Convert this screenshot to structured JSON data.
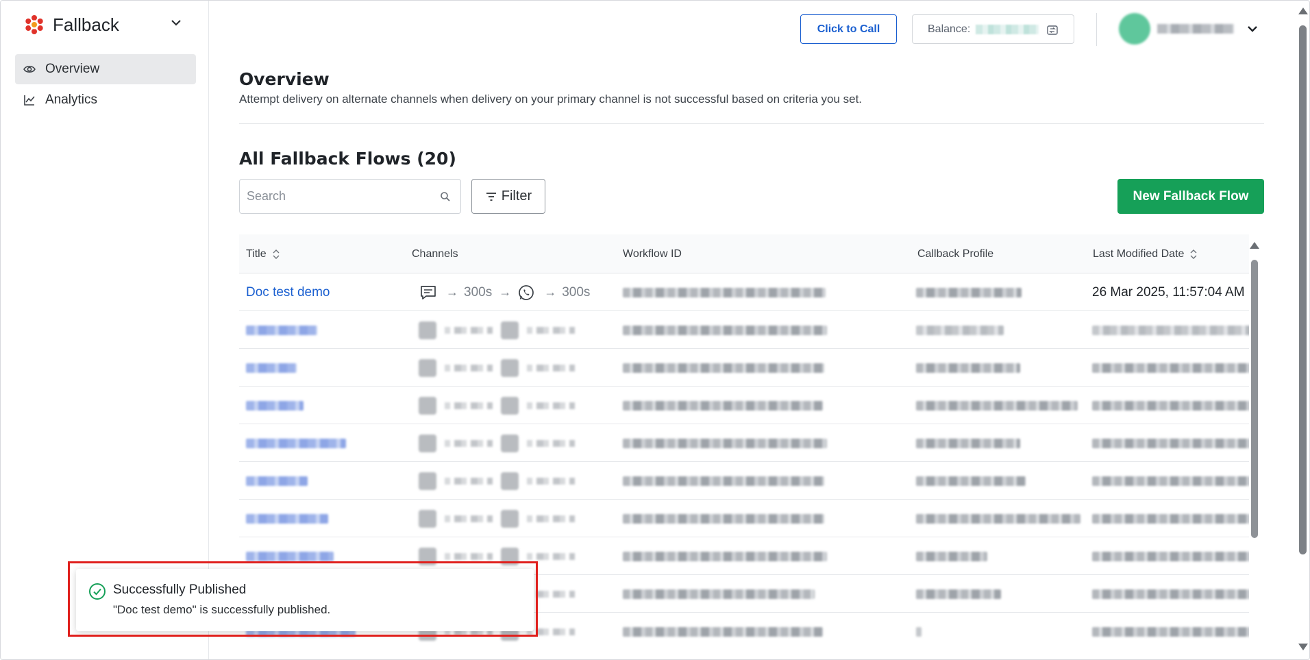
{
  "sidebar": {
    "brand": "Fallback",
    "nav": [
      {
        "label": "Overview",
        "icon": "eye-icon",
        "active": true
      },
      {
        "label": "Analytics",
        "icon": "line-chart-icon",
        "active": false
      }
    ]
  },
  "header": {
    "click_to_call": "Click to Call",
    "balance_label": "Balance:"
  },
  "main": {
    "title": "Overview",
    "description": "Attempt delivery on alternate channels when delivery on your primary channel is not successful based on criteria you set.",
    "section_title": "All Fallback Flows (20)",
    "search_placeholder": "Search",
    "filter_label": "Filter",
    "new_flow_label": "New Fallback Flow"
  },
  "table": {
    "columns": [
      "Title",
      "Channels",
      "Workflow ID",
      "Callback Profile",
      "Last Modified Date"
    ],
    "first_row": {
      "title": "Doc test demo",
      "channels": [
        {
          "icon": "sms-chat-icon",
          "arrow": "→",
          "duration": "300s"
        },
        {
          "icon": "whatsapp-icon",
          "arrow": "→",
          "duration": "300s"
        }
      ],
      "last_modified": "26 Mar 2025, 11:57:04 AM"
    },
    "blurred_rows": 9
  },
  "toast": {
    "title": "Successfully Published",
    "message": "\"Doc test demo\" is successfully published."
  },
  "colors": {
    "accent_blue": "#1a5fd0",
    "primary_green": "#16a058",
    "highlight_red": "#e0201d",
    "brand_red": "#e0322a"
  }
}
